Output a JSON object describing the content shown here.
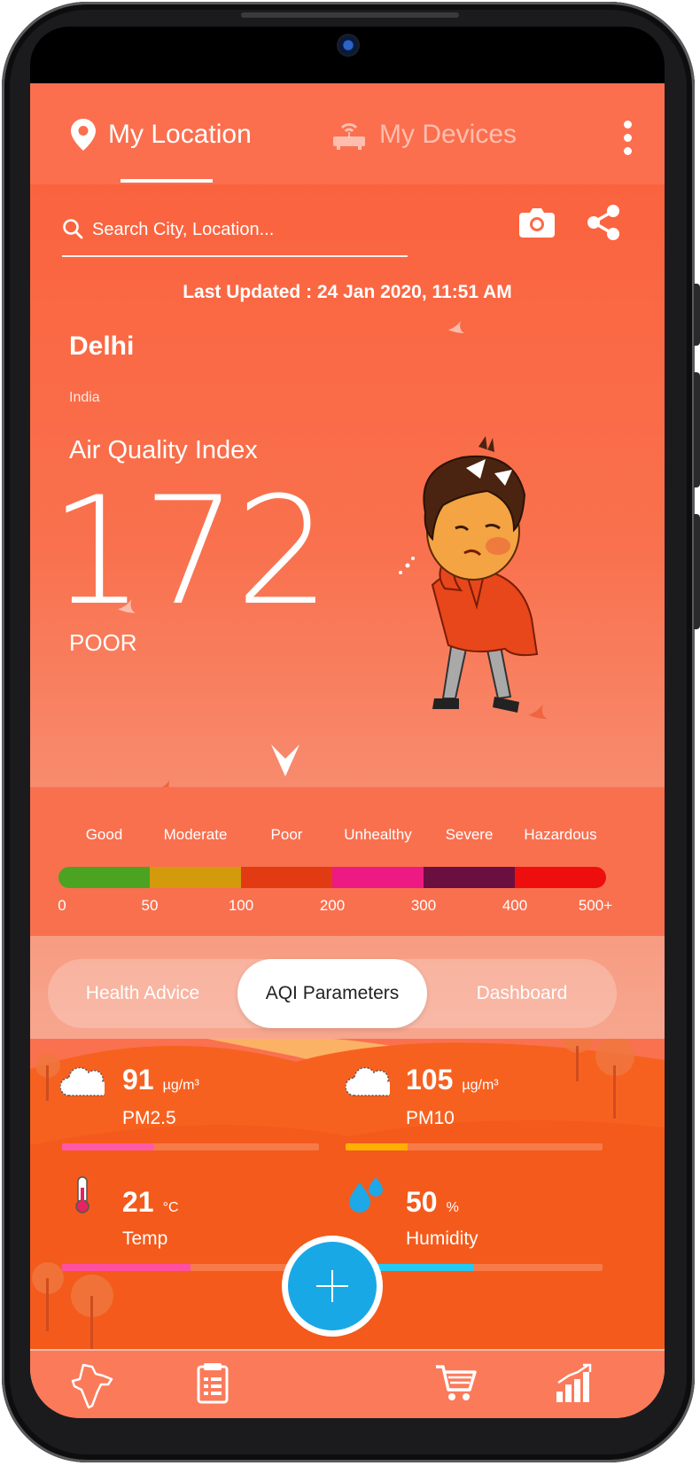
{
  "tabs": {
    "my_location": "My Location",
    "my_devices": "My Devices"
  },
  "search": {
    "placeholder": "Search City, Location..."
  },
  "last_updated": "Last Updated : 24 Jan 2020, 11:51 AM",
  "location": {
    "city": "Delhi",
    "country": "India"
  },
  "aqi": {
    "label": "Air Quality Index",
    "value": "172",
    "status": "POOR"
  },
  "scale": {
    "categories": [
      "Good",
      "Moderate",
      "Poor",
      "Unhealthy",
      "Severe",
      "Hazardous"
    ],
    "colors": [
      "#4ba321",
      "#d39a0c",
      "#e23a12",
      "#ee1a84",
      "#6b0f40",
      "#ef0e0e"
    ],
    "ticks": [
      "0",
      "50",
      "100",
      "200",
      "300",
      "400",
      "500+"
    ]
  },
  "segments": {
    "health_advice": "Health Advice",
    "aqi_parameters": "AQI Parameters",
    "dashboard": "Dashboard",
    "selected": "AQI Parameters"
  },
  "parameters": {
    "pm25": {
      "value": "91",
      "unit": "µg/m³",
      "name": "PM2.5",
      "level": 0.36,
      "color": "#ff5aa8"
    },
    "pm10": {
      "value": "105",
      "unit": "µg/m³",
      "name": "PM10",
      "level": 0.24,
      "color": "#ffb000"
    },
    "temp": {
      "value": "21",
      "unit": "°C",
      "name": "Temp",
      "level": 0.5,
      "color": "#ff4fa0"
    },
    "humidity": {
      "value": "50",
      "unit": "%",
      "name": "Humidity",
      "level": 0.5,
      "color": "#23c9f2"
    }
  },
  "icons": {
    "location": "location-pin-icon",
    "devices": "router-icon",
    "search": "search-icon",
    "camera": "camera-icon",
    "share": "share-icon",
    "map": "india-map-icon",
    "report": "report-icon",
    "add": "plus-icon",
    "cart": "cart-icon",
    "stats": "bar-chart-icon"
  }
}
